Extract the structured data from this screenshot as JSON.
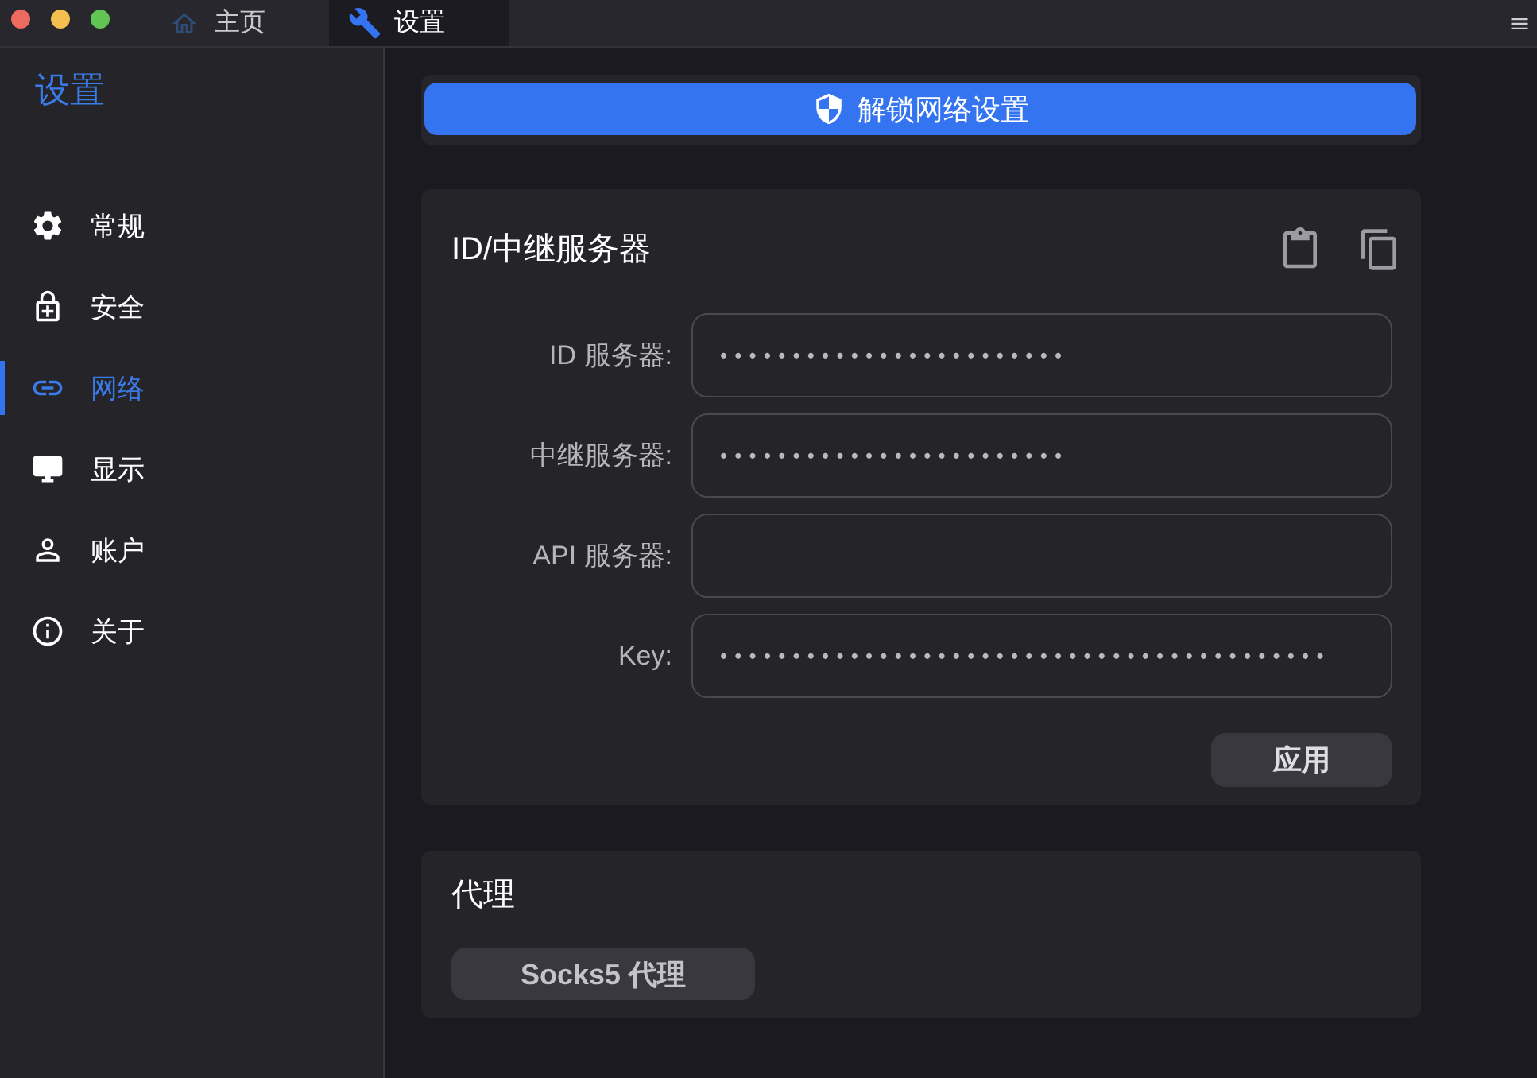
{
  "window_tabs": [
    {
      "label": "主页",
      "selected": false
    },
    {
      "label": "设置",
      "selected": true
    }
  ],
  "sidebar": {
    "title": "设置",
    "items": [
      {
        "label": "常规",
        "selected": false
      },
      {
        "label": "安全",
        "selected": false
      },
      {
        "label": "网络",
        "selected": true
      },
      {
        "label": "显示",
        "selected": false
      },
      {
        "label": "账户",
        "selected": false
      },
      {
        "label": "关于",
        "selected": false
      }
    ]
  },
  "unlock_button": {
    "label": "解锁网络设置"
  },
  "server_card": {
    "title": "ID/中继服务器",
    "fields": [
      {
        "label": "ID 服务器:",
        "value": "••••••••••••••••••••••••"
      },
      {
        "label": "中继服务器:",
        "value": "••••••••••••••••••••••••"
      },
      {
        "label": "API 服务器:"
      },
      {
        "label": "Key:",
        "value": "••••••••••••••••••••••••••••••••••••••••••"
      }
    ],
    "apply_button": {
      "label": "应用"
    }
  },
  "proxy_card": {
    "title": "代理",
    "socks5_button": {
      "label": "Socks5 代理"
    }
  }
}
